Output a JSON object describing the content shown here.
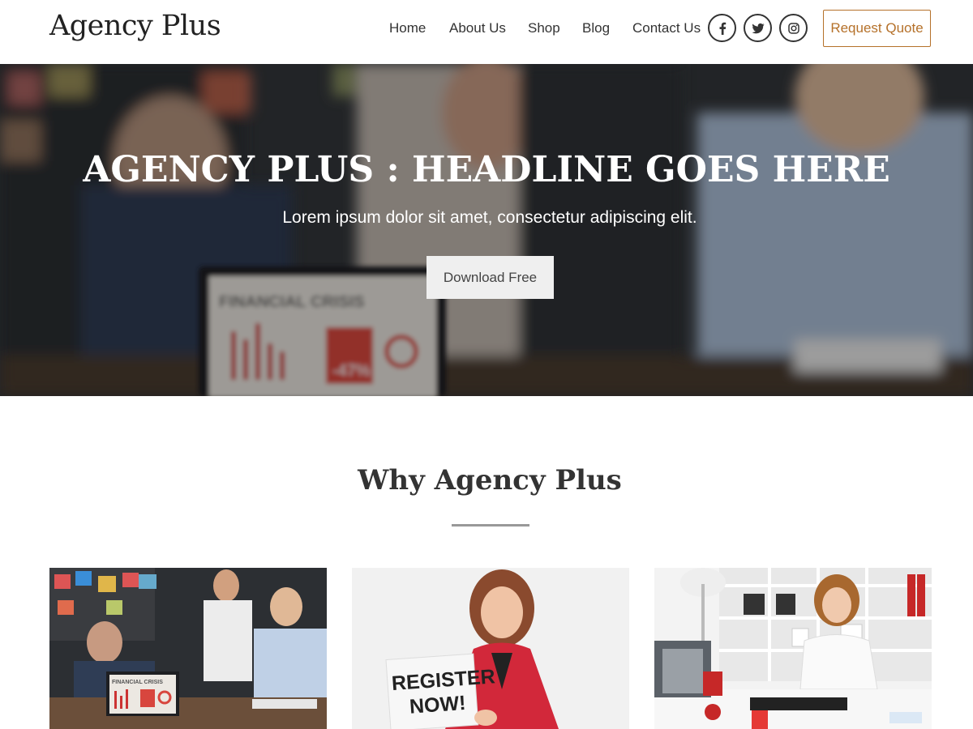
{
  "header": {
    "logo": "Agency Plus",
    "nav": [
      "Home",
      "About Us",
      "Shop",
      "Blog",
      "Contact Us"
    ],
    "social": [
      "facebook-icon",
      "twitter-icon",
      "instagram-icon"
    ],
    "cta_label": "Request Quote"
  },
  "hero": {
    "title": "AGENCY PLUS : HEADLINE GOES HERE",
    "subtitle": "Lorem ipsum dolor sit amet, consectetur adipiscing elit.",
    "button_label": "Download Free",
    "image_text": {
      "laptop_heading": "FINANCIAL CRISIS",
      "laptop_percent": "-47%"
    }
  },
  "why": {
    "title": "Why Agency Plus",
    "cards": [
      {
        "image": "office-meeting-photo",
        "image_text": "FINANCIAL CRISIS"
      },
      {
        "image": "woman-register-sign-photo",
        "sign_text": "REGISTER NOW!"
      },
      {
        "image": "woman-on-phone-office-photo"
      }
    ]
  },
  "colors": {
    "accent": "#b5712a",
    "text": "#333333",
    "divider": "#999999"
  }
}
